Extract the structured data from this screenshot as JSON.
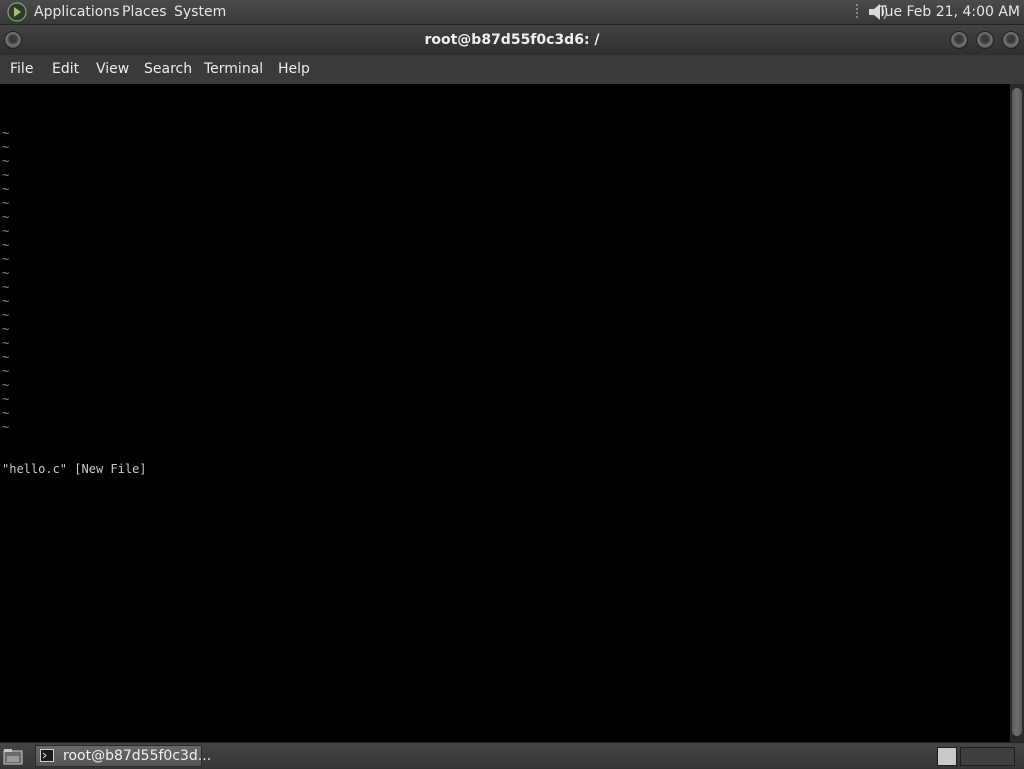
{
  "top_panel": {
    "menus": [
      "Applications",
      "Places",
      "System"
    ],
    "clock": "Tue Feb 21,  4:00 AM",
    "icons": {
      "apps": "gnome-foot-icon",
      "volume": "speaker-icon"
    }
  },
  "window": {
    "title": "root@b87d55f0c3d6: /",
    "menus": [
      "File",
      "Edit",
      "View",
      "Search",
      "Terminal",
      "Help"
    ]
  },
  "terminal": {
    "empty_line_marker": "~",
    "empty_line_count": 22,
    "status_filename": "\"hello.c\"",
    "status_note": "[New File]"
  },
  "bottom_panel": {
    "task_label": "root@b87d55f0c3d...",
    "icons": {
      "show_desktop": "show-desktop-icon",
      "task": "terminal-icon"
    }
  },
  "colors": {
    "panel": "#3c3c3c",
    "terminal_bg": "#000000",
    "terminal_fg": "#a8a8a8"
  }
}
